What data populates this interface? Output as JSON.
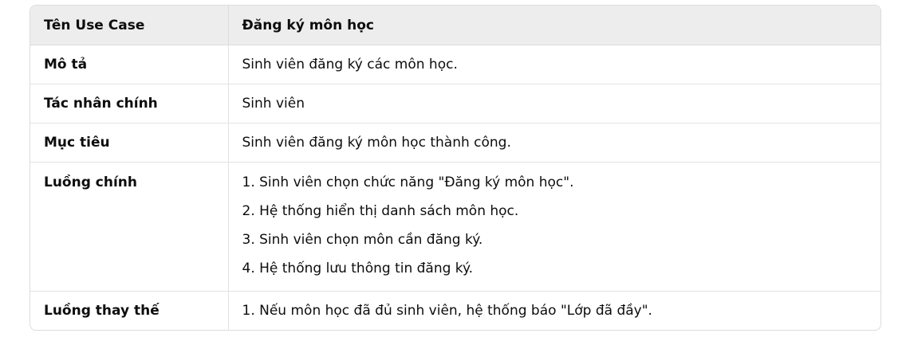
{
  "header": {
    "col1": "Tên Use Case",
    "col2": "Đăng ký môn học"
  },
  "rows": [
    {
      "label": "Mô tả",
      "value": "Sinh viên đăng ký các môn học."
    },
    {
      "label": "Tác nhân chính",
      "value": "Sinh viên"
    },
    {
      "label": "Mục tiêu",
      "value": "Sinh viên đăng ký môn học thành công."
    },
    {
      "label": "Luồng chính",
      "steps": [
        "1. Sinh viên chọn chức năng \"Đăng ký môn học\".",
        "2. Hệ thống hiển thị danh sách môn học.",
        "3. Sinh viên chọn môn cần đăng ký.",
        "4. Hệ thống lưu thông tin đăng ký."
      ]
    },
    {
      "label": "Luồng thay thế",
      "value": "1. Nếu môn học đã đủ sinh viên, hệ thống báo \"Lớp đã đầy\"."
    }
  ]
}
